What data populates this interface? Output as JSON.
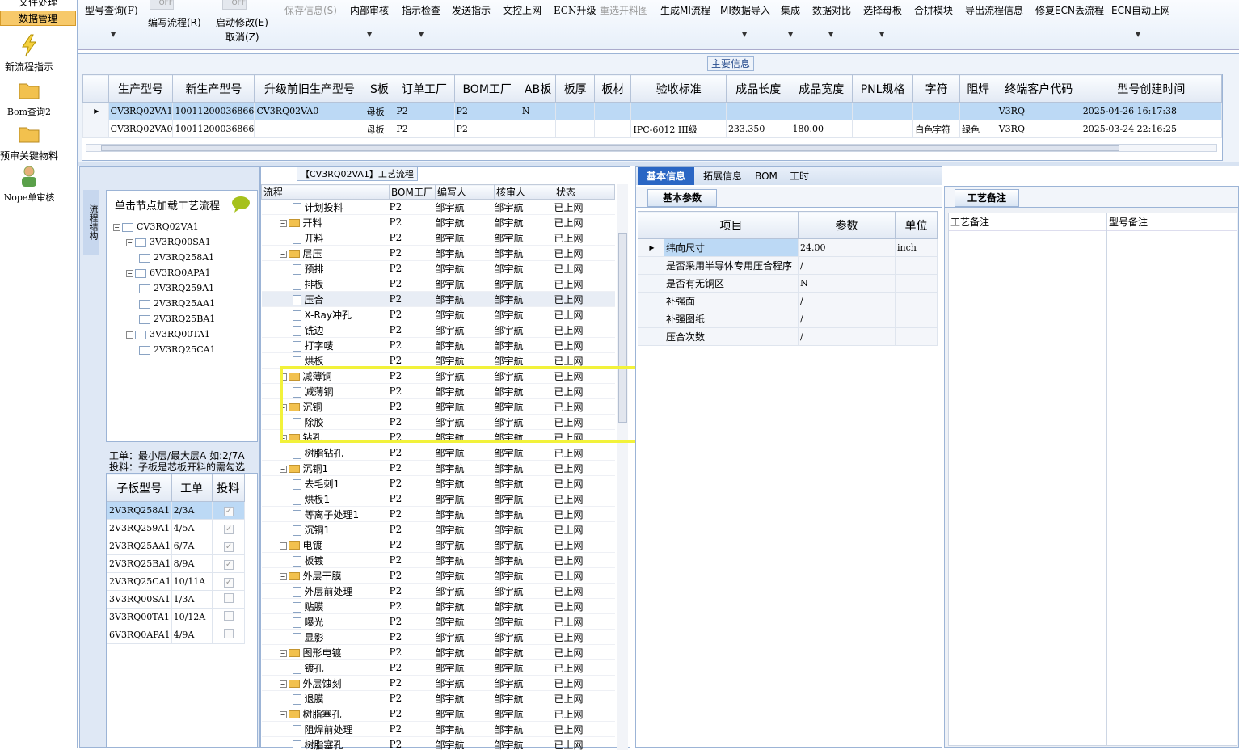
{
  "nav": {
    "file": "文件处理",
    "data": "数据管理",
    "new_flow": "新流程指示",
    "bom_query": "Bom查询2",
    "prereview": "预审关键物料",
    "nope": "Nope单审核"
  },
  "toolbar": {
    "model_query": "型号查询(F)",
    "write_flow": "编写流程(R)",
    "start_edit": "启动修改(E)",
    "cancel": "取消(Z)",
    "save": "保存信息(S)",
    "internal": "内部审核",
    "check": "指示检查",
    "send": "发送指示",
    "upload": "文控上网",
    "ecn": "ECN升级",
    "reselect": "重选开料图",
    "gen_mi": "生成MI流程",
    "mi_import": "MI数据导入",
    "integrate": "集成",
    "compare": "数据对比",
    "select_mother": "选择母板",
    "merge": "合拼模块",
    "export_flow": "导出流程信息",
    "fix_ecn": "修复ECN丢流程",
    "ecn_auto": "ECN自动上网",
    "toggle1": "OFF",
    "toggle2": "OFF"
  },
  "main_info": {
    "title": "主要信息",
    "headers": [
      "生产型号",
      "新生产型号",
      "升级前旧生产型号",
      "S板",
      "订单工厂",
      "BOM工厂",
      "AB板",
      "板厚",
      "板材",
      "验收标准",
      "成品长度",
      "成品宽度",
      "PNL规格",
      "字符",
      "阻焊",
      "终端客户代码",
      "型号创建时间"
    ],
    "rows": [
      [
        "CV3RQ02VA1",
        "10011200036866",
        "CV3RQ02VA0",
        "母板",
        "P2",
        "P2",
        "N",
        "",
        "",
        "",
        "",
        "",
        "",
        "",
        "",
        "V3RQ",
        "2025-04-26 16:17:38"
      ],
      [
        "CV3RQ02VA0",
        "10011200036866",
        "",
        "母板",
        "P2",
        "P2",
        "",
        "",
        "",
        "IPC-6012 III级",
        "233.350",
        "180.00",
        "",
        "白色字符",
        "绿色",
        "V3RQ",
        "2025-03-24 22:16:25"
      ]
    ]
  },
  "flow_panel": {
    "title": "【CV3RQ02VA1】工艺流程",
    "side_tab": "流程结构",
    "hint": "单击节点加载工艺流程",
    "tree": [
      "CV3RQ02VA1",
      "3V3RQ00SA1",
      "2V3RQ258A1",
      "6V3RQ0APA1",
      "2V3RQ259A1",
      "2V3RQ25AA1",
      "2V3RQ25BA1",
      "3V3RQ00TA1",
      "2V3RQ25CA1"
    ],
    "note1": "工单：最小层/最大层A 如:2/7A",
    "note2": "投料：子板是芯板开料的需勾选",
    "sub_headers": [
      "子板型号",
      "工单",
      "投料"
    ],
    "sub_rows": [
      [
        "2V3RQ258A1",
        "2/3A",
        true
      ],
      [
        "2V3RQ259A1",
        "4/5A",
        true
      ],
      [
        "2V3RQ25AA1",
        "6/7A",
        true
      ],
      [
        "2V3RQ25BA1",
        "8/9A",
        true
      ],
      [
        "2V3RQ25CA1",
        "10/11A",
        true
      ],
      [
        "3V3RQ00SA1",
        "1/3A",
        false
      ],
      [
        "3V3RQ00TA1",
        "10/12A",
        false
      ],
      [
        "6V3RQ0APA1",
        "4/9A",
        false
      ]
    ]
  },
  "process": {
    "headers": [
      "流程",
      "BOM工厂",
      "编写人",
      "核审人",
      "状态"
    ],
    "rows": [
      [
        "计划投料",
        2,
        "P2",
        "邹宇航",
        "邹宇航",
        "已上网"
      ],
      [
        "开料",
        1,
        "P2",
        "邹宇航",
        "邹宇航",
        "已上网"
      ],
      [
        "开料",
        2,
        "P2",
        "邹宇航",
        "邹宇航",
        "已上网"
      ],
      [
        "层压",
        1,
        "P2",
        "邹宇航",
        "邹宇航",
        "已上网"
      ],
      [
        "预排",
        2,
        "P2",
        "邹宇航",
        "邹宇航",
        "已上网"
      ],
      [
        "排板",
        2,
        "P2",
        "邹宇航",
        "邹宇航",
        "已上网"
      ],
      [
        "压合",
        2,
        "P2",
        "邹宇航",
        "邹宇航",
        "已上网"
      ],
      [
        "X-Ray冲孔",
        2,
        "P2",
        "邹宇航",
        "邹宇航",
        "已上网"
      ],
      [
        "铣边",
        2,
        "P2",
        "邹宇航",
        "邹宇航",
        "已上网"
      ],
      [
        "打字唛",
        2,
        "P2",
        "邹宇航",
        "邹宇航",
        "已上网"
      ],
      [
        "烘板",
        2,
        "P2",
        "邹宇航",
        "邹宇航",
        "已上网"
      ],
      [
        "减薄铜",
        1,
        "P2",
        "邹宇航",
        "邹宇航",
        "已上网"
      ],
      [
        "减薄铜",
        2,
        "P2",
        "邹宇航",
        "邹宇航",
        "已上网"
      ],
      [
        "沉铜",
        1,
        "P2",
        "邹宇航",
        "邹宇航",
        "已上网"
      ],
      [
        "除胶",
        2,
        "P2",
        "邹宇航",
        "邹宇航",
        "已上网"
      ],
      [
        "钻孔",
        1,
        "P2",
        "邹宇航",
        "邹宇航",
        "已上网"
      ],
      [
        "树脂钻孔",
        2,
        "P2",
        "邹宇航",
        "邹宇航",
        "已上网"
      ],
      [
        "沉铜1",
        1,
        "P2",
        "邹宇航",
        "邹宇航",
        "已上网"
      ],
      [
        "去毛刺1",
        2,
        "P2",
        "邹宇航",
        "邹宇航",
        "已上网"
      ],
      [
        "烘板1",
        2,
        "P2",
        "邹宇航",
        "邹宇航",
        "已上网"
      ],
      [
        "等离子处理1",
        2,
        "P2",
        "邹宇航",
        "邹宇航",
        "已上网"
      ],
      [
        "沉铜1",
        2,
        "P2",
        "邹宇航",
        "邹宇航",
        "已上网"
      ],
      [
        "电镀",
        1,
        "P2",
        "邹宇航",
        "邹宇航",
        "已上网"
      ],
      [
        "板镀",
        2,
        "P2",
        "邹宇航",
        "邹宇航",
        "已上网"
      ],
      [
        "外层干膜",
        1,
        "P2",
        "邹宇航",
        "邹宇航",
        "已上网"
      ],
      [
        "外层前处理",
        2,
        "P2",
        "邹宇航",
        "邹宇航",
        "已上网"
      ],
      [
        "贴膜",
        2,
        "P2",
        "邹宇航",
        "邹宇航",
        "已上网"
      ],
      [
        "曝光",
        2,
        "P2",
        "邹宇航",
        "邹宇航",
        "已上网"
      ],
      [
        "显影",
        2,
        "P2",
        "邹宇航",
        "邹宇航",
        "已上网"
      ],
      [
        "图形电镀",
        1,
        "P2",
        "邹宇航",
        "邹宇航",
        "已上网"
      ],
      [
        "镀孔",
        2,
        "P2",
        "邹宇航",
        "邹宇航",
        "已上网"
      ],
      [
        "外层蚀刻",
        1,
        "P2",
        "邹宇航",
        "邹宇航",
        "已上网"
      ],
      [
        "退膜",
        2,
        "P2",
        "邹宇航",
        "邹宇航",
        "已上网"
      ],
      [
        "树脂塞孔",
        1,
        "P2",
        "邹宇航",
        "邹宇航",
        "已上网"
      ],
      [
        "阻焊前处理",
        2,
        "P2",
        "邹宇航",
        "邹宇航",
        "已上网"
      ],
      [
        "树脂塞孔",
        2,
        "P2",
        "邹宇航",
        "邹宇航",
        "已上网"
      ]
    ]
  },
  "detail": {
    "tabs": [
      "基本信息",
      "拓展信息",
      "BOM",
      "工时"
    ],
    "sub_tab": "基本参数",
    "headers": [
      "项目",
      "参数",
      "单位"
    ],
    "rows": [
      [
        "纬向尺寸",
        "24.00",
        "inch"
      ],
      [
        "是否采用半导体专用压合程序",
        "/",
        ""
      ],
      [
        "是否有无铜区",
        "N",
        ""
      ],
      [
        "补强面",
        "/",
        ""
      ],
      [
        "补强图纸",
        "/",
        ""
      ],
      [
        "压合次数",
        "/",
        ""
      ]
    ]
  },
  "remarks": {
    "tab": "工艺备注",
    "col1": "工艺备注",
    "col2": "型号备注"
  }
}
